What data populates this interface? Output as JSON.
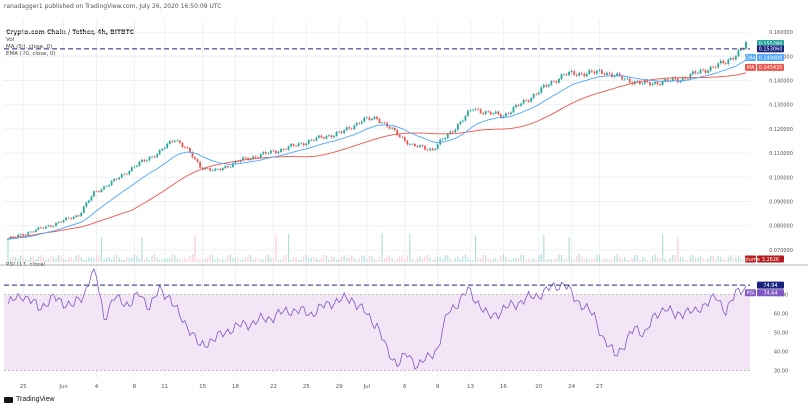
{
  "header": {
    "text": "ranadagger1 published on TradingView.com, July 26, 2020 16:50:09 UTC"
  },
  "legend": {
    "symbol": "Crypto.com Chain / Tether, 4h, BITBTC",
    "vol": "Vol",
    "ma": "MA (50, close, 0)",
    "ema": "EMA (20, close, 0)",
    "rsi": "RSI (14, close)"
  },
  "footer": {
    "brand": "TradingView"
  },
  "colors": {
    "up": "#26a69a",
    "down": "#ef5350",
    "ema": "#4da6ff",
    "ma": "#f0544c",
    "rsi": "#7e57c2",
    "rsi_bg": "#f3e5f5",
    "dash": "#1a237e",
    "grid": "#eef0f4"
  },
  "price_axis": {
    "labels": [
      "0.160000",
      "0.150000",
      "0.140000",
      "0.130000",
      "0.120000",
      "0.110000",
      "0.100000",
      "0.090000",
      "0.080000",
      "0.070000"
    ]
  },
  "price_tags": {
    "price": "0.155280",
    "level": "0.153060",
    "ema": "0.149488",
    "ma": "0.145435",
    "ema_label": "EMA",
    "ma_label": "MA",
    "volume": "3.262K",
    "volume_label": "Volume"
  },
  "rsi_axis": {
    "labels": [
      "70.00",
      "60.00",
      "50.00",
      "40.00",
      "30.00"
    ]
  },
  "rsi_tags": {
    "level": "74.94",
    "value": "74.64",
    "label": "RSI"
  },
  "x_axis": {
    "labels": [
      "25",
      "Jun",
      "4",
      "8",
      "11",
      "15",
      "18",
      "22",
      "25",
      "29",
      "Jul",
      "6",
      "9",
      "13",
      "16",
      "20",
      "24",
      "27"
    ]
  },
  "chart_data": {
    "type": "candlestick",
    "symbol": "Crypto.com Chain / Tether, 4h, BITBTC",
    "interval": "4h",
    "price_range": [
      0.065,
      0.165
    ],
    "rsi_range": [
      26,
      84
    ],
    "horizontal_level_price": 0.15306,
    "horizontal_level_rsi": 74.94,
    "last": {
      "price": 0.15528,
      "ema20": 0.149488,
      "ma50": 0.145435,
      "volume": "3.262K",
      "rsi": 74.64
    },
    "price_path": [
      [
        0,
        0.0745
      ],
      [
        18,
        0.0805
      ],
      [
        28,
        0.0845
      ],
      [
        34,
        0.0935
      ],
      [
        42,
        0.0985
      ],
      [
        50,
        0.1045
      ],
      [
        60,
        0.1105
      ],
      [
        66,
        0.116
      ],
      [
        70,
        0.1125
      ],
      [
        76,
        0.1045
      ],
      [
        82,
        0.1025
      ],
      [
        92,
        0.107
      ],
      [
        110,
        0.112
      ],
      [
        124,
        0.1165
      ],
      [
        132,
        0.1185
      ],
      [
        140,
        0.1235
      ],
      [
        146,
        0.1245
      ],
      [
        152,
        0.1195
      ],
      [
        160,
        0.113
      ],
      [
        168,
        0.1115
      ],
      [
        176,
        0.1195
      ],
      [
        184,
        0.1285
      ],
      [
        190,
        0.1265
      ],
      [
        196,
        0.1255
      ],
      [
        206,
        0.1325
      ],
      [
        214,
        0.1385
      ],
      [
        220,
        0.1425
      ],
      [
        236,
        0.1435
      ],
      [
        244,
        0.1405
      ],
      [
        252,
        0.1385
      ],
      [
        266,
        0.1405
      ],
      [
        276,
        0.1445
      ],
      [
        284,
        0.1475
      ],
      [
        291,
        0.1535
      ],
      [
        292,
        0.15528
      ]
    ],
    "rsi_path": [
      [
        0,
        65
      ],
      [
        6,
        70
      ],
      [
        12,
        63
      ],
      [
        18,
        68
      ],
      [
        22,
        66
      ],
      [
        26,
        64
      ],
      [
        30,
        70
      ],
      [
        33,
        81
      ],
      [
        35,
        79
      ],
      [
        38,
        58
      ],
      [
        42,
        68
      ],
      [
        48,
        65
      ],
      [
        52,
        70
      ],
      [
        56,
        64
      ],
      [
        60,
        72
      ],
      [
        64,
        69
      ],
      [
        68,
        58
      ],
      [
        72,
        52
      ],
      [
        76,
        42
      ],
      [
        80,
        46
      ],
      [
        84,
        48
      ],
      [
        88,
        52
      ],
      [
        96,
        55
      ],
      [
        104,
        58
      ],
      [
        112,
        62
      ],
      [
        120,
        60
      ],
      [
        128,
        66
      ],
      [
        136,
        68
      ],
      [
        140,
        62
      ],
      [
        146,
        54
      ],
      [
        150,
        40
      ],
      [
        154,
        34
      ],
      [
        158,
        38
      ],
      [
        162,
        33
      ],
      [
        166,
        36
      ],
      [
        170,
        42
      ],
      [
        174,
        60
      ],
      [
        178,
        66
      ],
      [
        182,
        72
      ],
      [
        186,
        66
      ],
      [
        190,
        58
      ],
      [
        196,
        62
      ],
      [
        202,
        66
      ],
      [
        210,
        70
      ],
      [
        216,
        74
      ],
      [
        220,
        76
      ],
      [
        224,
        68
      ],
      [
        228,
        64
      ],
      [
        232,
        58
      ],
      [
        236,
        46
      ],
      [
        240,
        38
      ],
      [
        244,
        44
      ],
      [
        248,
        52
      ],
      [
        252,
        50
      ],
      [
        256,
        58
      ],
      [
        260,
        64
      ],
      [
        264,
        58
      ],
      [
        268,
        62
      ],
      [
        272,
        60
      ],
      [
        276,
        66
      ],
      [
        280,
        68
      ],
      [
        284,
        62
      ],
      [
        288,
        70
      ],
      [
        292,
        74.64
      ]
    ]
  }
}
